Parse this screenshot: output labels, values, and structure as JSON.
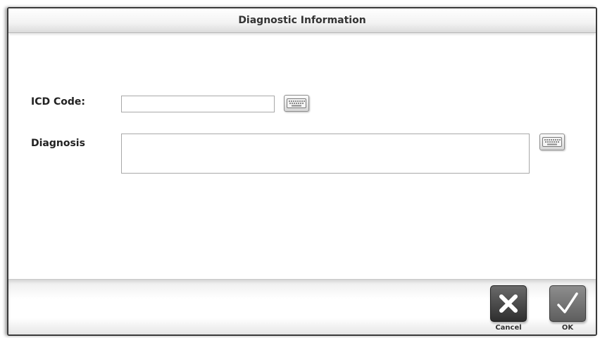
{
  "dialog": {
    "title": "Diagnostic Information"
  },
  "form": {
    "icd_code": {
      "label": "ICD Code:",
      "value": "",
      "keyboard_icon": "keyboard-icon"
    },
    "diagnosis": {
      "label": "Diagnosis",
      "value": "",
      "keyboard_icon": "keyboard-icon"
    }
  },
  "footer": {
    "cancel": {
      "label": "Cancel",
      "icon": "close-icon"
    },
    "ok": {
      "label": "OK",
      "icon": "checkmark-icon"
    }
  }
}
